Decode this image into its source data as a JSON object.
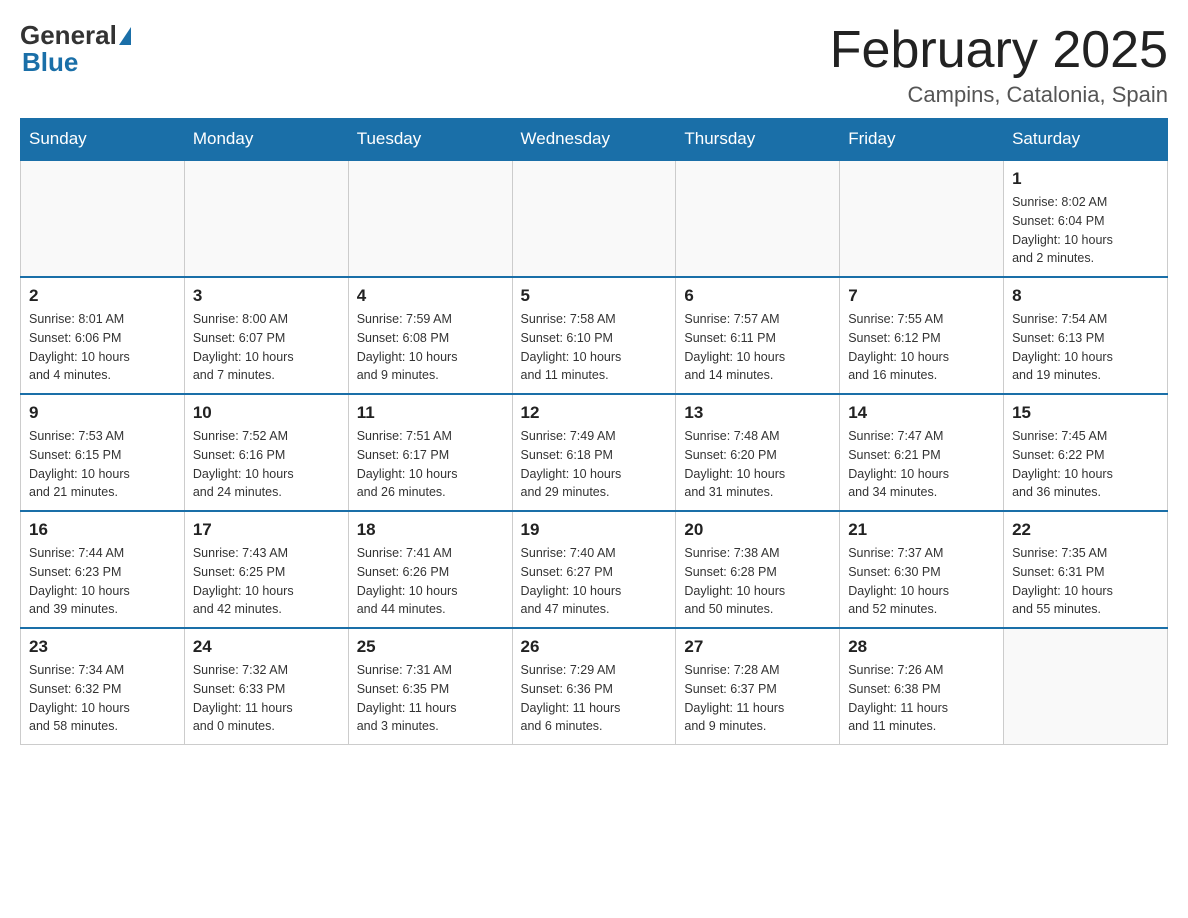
{
  "header": {
    "logo_general": "General",
    "logo_blue": "Blue",
    "month_title": "February 2025",
    "location": "Campins, Catalonia, Spain"
  },
  "weekdays": [
    "Sunday",
    "Monday",
    "Tuesday",
    "Wednesday",
    "Thursday",
    "Friday",
    "Saturday"
  ],
  "weeks": [
    [
      {
        "day": "",
        "info": ""
      },
      {
        "day": "",
        "info": ""
      },
      {
        "day": "",
        "info": ""
      },
      {
        "day": "",
        "info": ""
      },
      {
        "day": "",
        "info": ""
      },
      {
        "day": "",
        "info": ""
      },
      {
        "day": "1",
        "info": "Sunrise: 8:02 AM\nSunset: 6:04 PM\nDaylight: 10 hours\nand 2 minutes."
      }
    ],
    [
      {
        "day": "2",
        "info": "Sunrise: 8:01 AM\nSunset: 6:06 PM\nDaylight: 10 hours\nand 4 minutes."
      },
      {
        "day": "3",
        "info": "Sunrise: 8:00 AM\nSunset: 6:07 PM\nDaylight: 10 hours\nand 7 minutes."
      },
      {
        "day": "4",
        "info": "Sunrise: 7:59 AM\nSunset: 6:08 PM\nDaylight: 10 hours\nand 9 minutes."
      },
      {
        "day": "5",
        "info": "Sunrise: 7:58 AM\nSunset: 6:10 PM\nDaylight: 10 hours\nand 11 minutes."
      },
      {
        "day": "6",
        "info": "Sunrise: 7:57 AM\nSunset: 6:11 PM\nDaylight: 10 hours\nand 14 minutes."
      },
      {
        "day": "7",
        "info": "Sunrise: 7:55 AM\nSunset: 6:12 PM\nDaylight: 10 hours\nand 16 minutes."
      },
      {
        "day": "8",
        "info": "Sunrise: 7:54 AM\nSunset: 6:13 PM\nDaylight: 10 hours\nand 19 minutes."
      }
    ],
    [
      {
        "day": "9",
        "info": "Sunrise: 7:53 AM\nSunset: 6:15 PM\nDaylight: 10 hours\nand 21 minutes."
      },
      {
        "day": "10",
        "info": "Sunrise: 7:52 AM\nSunset: 6:16 PM\nDaylight: 10 hours\nand 24 minutes."
      },
      {
        "day": "11",
        "info": "Sunrise: 7:51 AM\nSunset: 6:17 PM\nDaylight: 10 hours\nand 26 minutes."
      },
      {
        "day": "12",
        "info": "Sunrise: 7:49 AM\nSunset: 6:18 PM\nDaylight: 10 hours\nand 29 minutes."
      },
      {
        "day": "13",
        "info": "Sunrise: 7:48 AM\nSunset: 6:20 PM\nDaylight: 10 hours\nand 31 minutes."
      },
      {
        "day": "14",
        "info": "Sunrise: 7:47 AM\nSunset: 6:21 PM\nDaylight: 10 hours\nand 34 minutes."
      },
      {
        "day": "15",
        "info": "Sunrise: 7:45 AM\nSunset: 6:22 PM\nDaylight: 10 hours\nand 36 minutes."
      }
    ],
    [
      {
        "day": "16",
        "info": "Sunrise: 7:44 AM\nSunset: 6:23 PM\nDaylight: 10 hours\nand 39 minutes."
      },
      {
        "day": "17",
        "info": "Sunrise: 7:43 AM\nSunset: 6:25 PM\nDaylight: 10 hours\nand 42 minutes."
      },
      {
        "day": "18",
        "info": "Sunrise: 7:41 AM\nSunset: 6:26 PM\nDaylight: 10 hours\nand 44 minutes."
      },
      {
        "day": "19",
        "info": "Sunrise: 7:40 AM\nSunset: 6:27 PM\nDaylight: 10 hours\nand 47 minutes."
      },
      {
        "day": "20",
        "info": "Sunrise: 7:38 AM\nSunset: 6:28 PM\nDaylight: 10 hours\nand 50 minutes."
      },
      {
        "day": "21",
        "info": "Sunrise: 7:37 AM\nSunset: 6:30 PM\nDaylight: 10 hours\nand 52 minutes."
      },
      {
        "day": "22",
        "info": "Sunrise: 7:35 AM\nSunset: 6:31 PM\nDaylight: 10 hours\nand 55 minutes."
      }
    ],
    [
      {
        "day": "23",
        "info": "Sunrise: 7:34 AM\nSunset: 6:32 PM\nDaylight: 10 hours\nand 58 minutes."
      },
      {
        "day": "24",
        "info": "Sunrise: 7:32 AM\nSunset: 6:33 PM\nDaylight: 11 hours\nand 0 minutes."
      },
      {
        "day": "25",
        "info": "Sunrise: 7:31 AM\nSunset: 6:35 PM\nDaylight: 11 hours\nand 3 minutes."
      },
      {
        "day": "26",
        "info": "Sunrise: 7:29 AM\nSunset: 6:36 PM\nDaylight: 11 hours\nand 6 minutes."
      },
      {
        "day": "27",
        "info": "Sunrise: 7:28 AM\nSunset: 6:37 PM\nDaylight: 11 hours\nand 9 minutes."
      },
      {
        "day": "28",
        "info": "Sunrise: 7:26 AM\nSunset: 6:38 PM\nDaylight: 11 hours\nand 11 minutes."
      },
      {
        "day": "",
        "info": ""
      }
    ]
  ]
}
